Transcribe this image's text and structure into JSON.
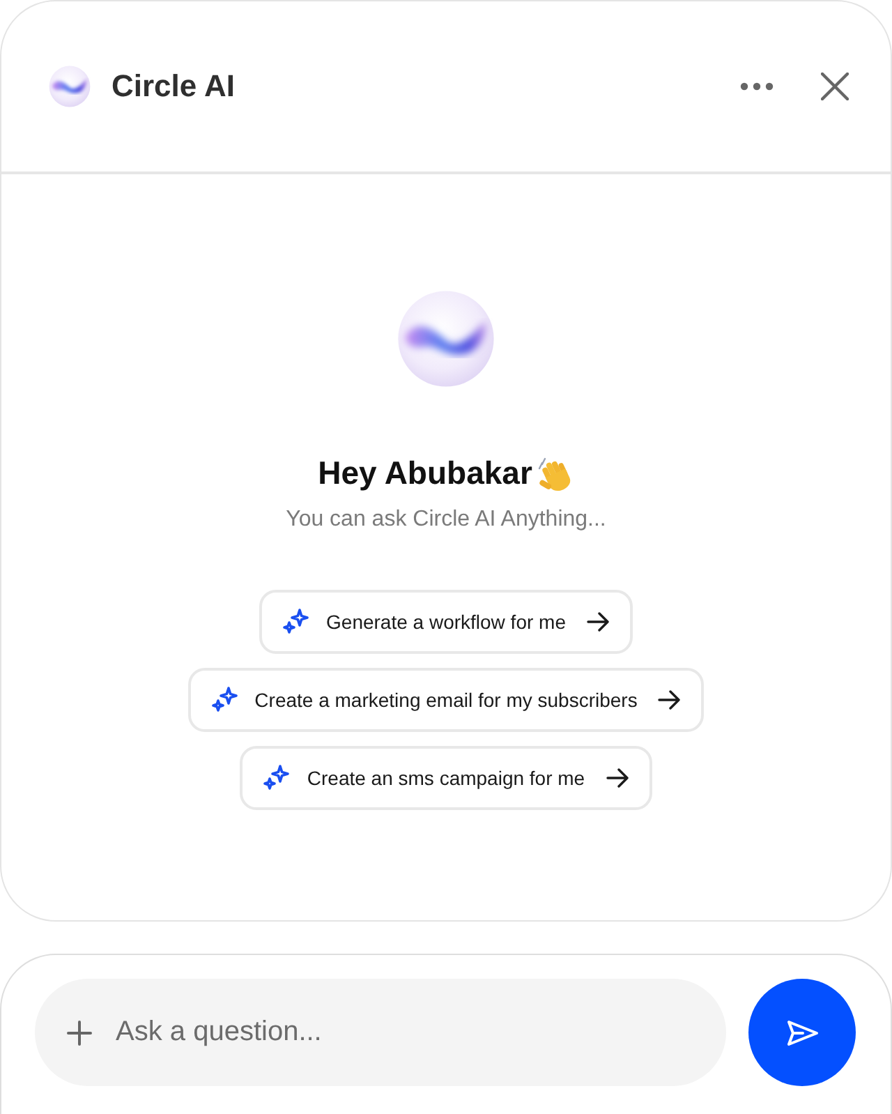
{
  "header": {
    "title": "Circle AI"
  },
  "greeting": {
    "title": "Hey Abubakar",
    "subtitle": "You can ask Circle AI Anything..."
  },
  "suggestions": [
    {
      "label": "Generate a workflow for me"
    },
    {
      "label": "Create a marketing email for my subscribers"
    },
    {
      "label": "Create an sms campaign for me"
    }
  ],
  "composer": {
    "placeholder": "Ask a question..."
  }
}
